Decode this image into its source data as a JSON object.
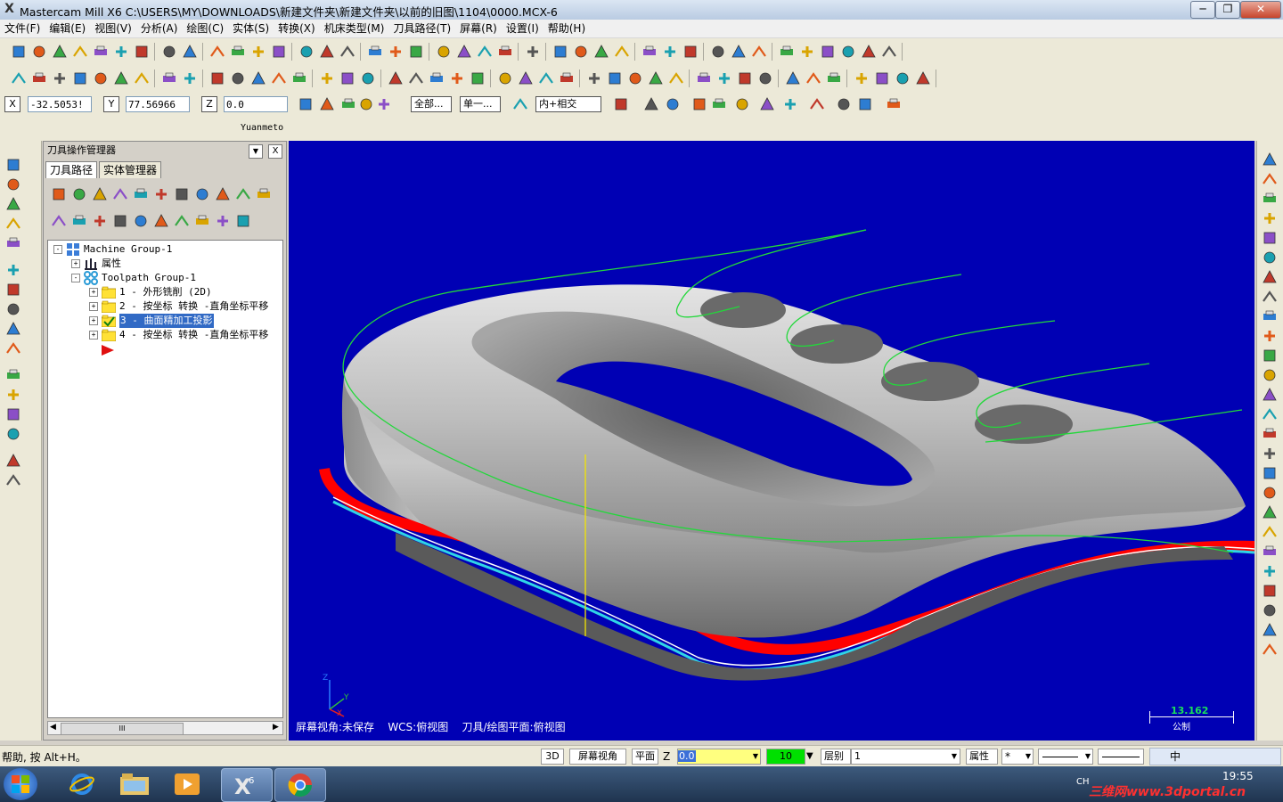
{
  "window": {
    "title": "Mastercam Mill X6  C:\\USERS\\MY\\DOWNLOADS\\新建文件夹\\新建文件夹\\以前的旧图\\1104\\0000.MCX-6",
    "app_icon": "X",
    "controls": {
      "minimize": "─",
      "restore": "❐",
      "close": "✕"
    }
  },
  "menu": [
    "文件(F)",
    "编辑(E)",
    "视图(V)",
    "分析(A)",
    "绘图(C)",
    "实体(S)",
    "转换(X)",
    "机床类型(M)",
    "刀具路径(T)",
    "屏幕(R)",
    "设置(I)",
    "帮助(H)"
  ],
  "coords": {
    "x_label": "X",
    "x_value": "-32.5053!",
    "y_label": "Y",
    "y_value": "77.56966",
    "z_label": "Z",
    "z_value": "0.0",
    "all_button": "全部...",
    "single_button": "单一...",
    "snap_mode": "内+相交"
  },
  "prompt": "Yuanmeto",
  "panel": {
    "title": "刀具操作管理器",
    "close": "X",
    "tabs": [
      "刀具路径",
      "实体管理器"
    ],
    "tree": {
      "machine_group": "Machine Group-1",
      "properties": "属性",
      "toolpath_group": "Toolpath Group-1",
      "ops": [
        {
          "label": "1 - 外形铣削 (2D)",
          "selected": false
        },
        {
          "label": "2 - 按坐标 转换 -直角坐标平移",
          "selected": false
        },
        {
          "label": "3 - 曲面精加工投影",
          "selected": true
        },
        {
          "label": "4 - 按坐标 转换 -直角坐标平移",
          "selected": false
        }
      ]
    },
    "scroll_mark": "III"
  },
  "viewport": {
    "background": "#0000b4",
    "info_view": "屏幕视角:未保存",
    "info_wcs": "WCS:俯视图",
    "info_plane": "刀具/绘图平面:俯视图",
    "scale_value": "13.162",
    "scale_unit": "公制",
    "axis_x": "X",
    "axis_y": "Y",
    "axis_z": "Z"
  },
  "status": {
    "help": "帮助, 按 Alt+H。",
    "view_3d": "3D",
    "screen_view": "屏幕视角",
    "plane": "平面",
    "z_label": "Z",
    "z_value": "0.0",
    "color_value": "10",
    "level_label": "层别",
    "level_value": "1",
    "attr": "属性",
    "point_style": "*"
  },
  "taskbar": {
    "time": "19:55",
    "lang": "CH",
    "ime_label": "中",
    "watermark": "三维网www.3dportal.cn"
  }
}
